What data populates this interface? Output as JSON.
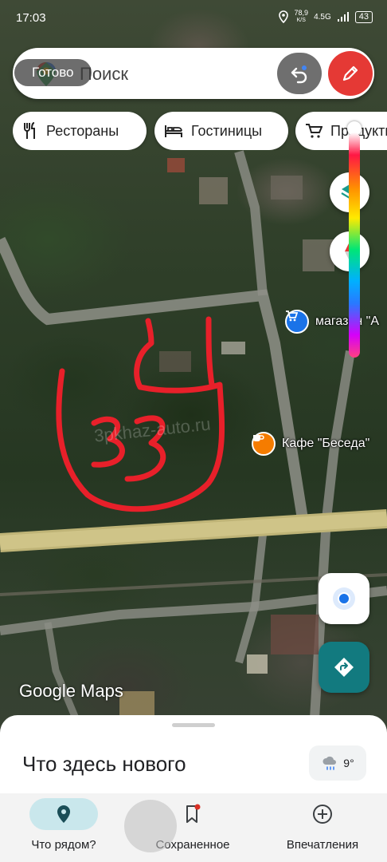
{
  "status_bar": {
    "time": "17:03",
    "net_speed_value": "78,9",
    "net_speed_unit": "K/S",
    "network": "4.5G",
    "battery": "43"
  },
  "search": {
    "placeholder": "Поиск",
    "done_label": "Готово"
  },
  "chips": [
    {
      "label": "Рестораны",
      "icon": "restaurant-icon"
    },
    {
      "label": "Гостиницы",
      "icon": "hotel-icon"
    },
    {
      "label": "Продукты",
      "icon": "cart-icon"
    }
  ],
  "map": {
    "poi_shop_label": "магазин \"А",
    "poi_cafe_label": "Кафе \"Беседа\"",
    "watermark": "3pkhaz-auto.ru",
    "drawn_annotation": "33",
    "google_logo": "Google Maps",
    "annotation_color": "#e8202a"
  },
  "sheet": {
    "title": "Что здесь нового",
    "weather_temp": "9°"
  },
  "nav": [
    {
      "label": "Что рядом?",
      "icon": "explore-pin-icon",
      "active": true
    },
    {
      "label": "Сохраненное",
      "icon": "bookmark-icon",
      "active": false
    },
    {
      "label": "Впечатления",
      "icon": "add-circle-icon",
      "active": false
    }
  ],
  "colors": {
    "accent_red": "#e53935",
    "nav_active": "#c9e7ec",
    "directions_teal": "#127a7f"
  }
}
